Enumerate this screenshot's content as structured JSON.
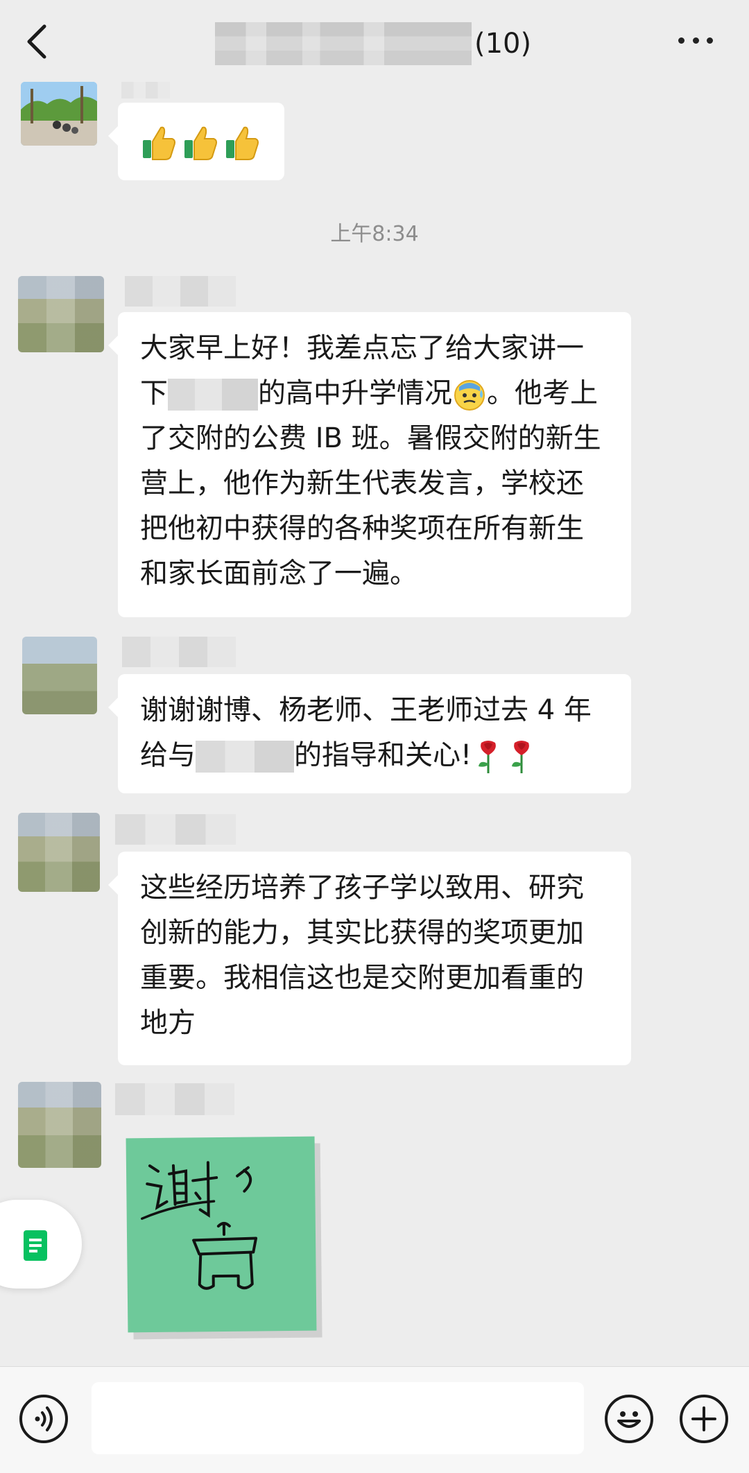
{
  "header": {
    "member_count": "(10)"
  },
  "timestamp": "上午8:34",
  "messages": [
    {
      "type": "emoji",
      "emoji": [
        "thumbs-up",
        "thumbs-up",
        "thumbs-up"
      ]
    },
    {
      "type": "text",
      "segments": [
        "大家早上好！我差点忘了给大家讲一下",
        "的高中升学情况",
        "。他考上了交附的公费 IB 班。暑假交附的新生营上，他作为新生代表发言，学校还把他初中获得的各种奖项在所有新生和家长面前念了一遍。"
      ],
      "emoji": "downcast-face-with-sweat"
    },
    {
      "type": "text",
      "segments": [
        "谢谢谢博、杨老师、王老师过去 4 年给与",
        "的指导和关心!"
      ],
      "emoji": [
        "rose",
        "rose"
      ]
    },
    {
      "type": "text",
      "text": "这些经历培养了孩子学以致用、研究创新的能力，其实比获得的奖项更加重要。我相信这也是交附更加看重的地方"
    },
    {
      "type": "sticker",
      "sticker_text": "谢々"
    }
  ],
  "input": {
    "placeholder": ""
  },
  "colors": {
    "background": "#ededed",
    "bubble": "#ffffff",
    "sticker": "#6ec99a",
    "accent_green": "#07c160"
  }
}
